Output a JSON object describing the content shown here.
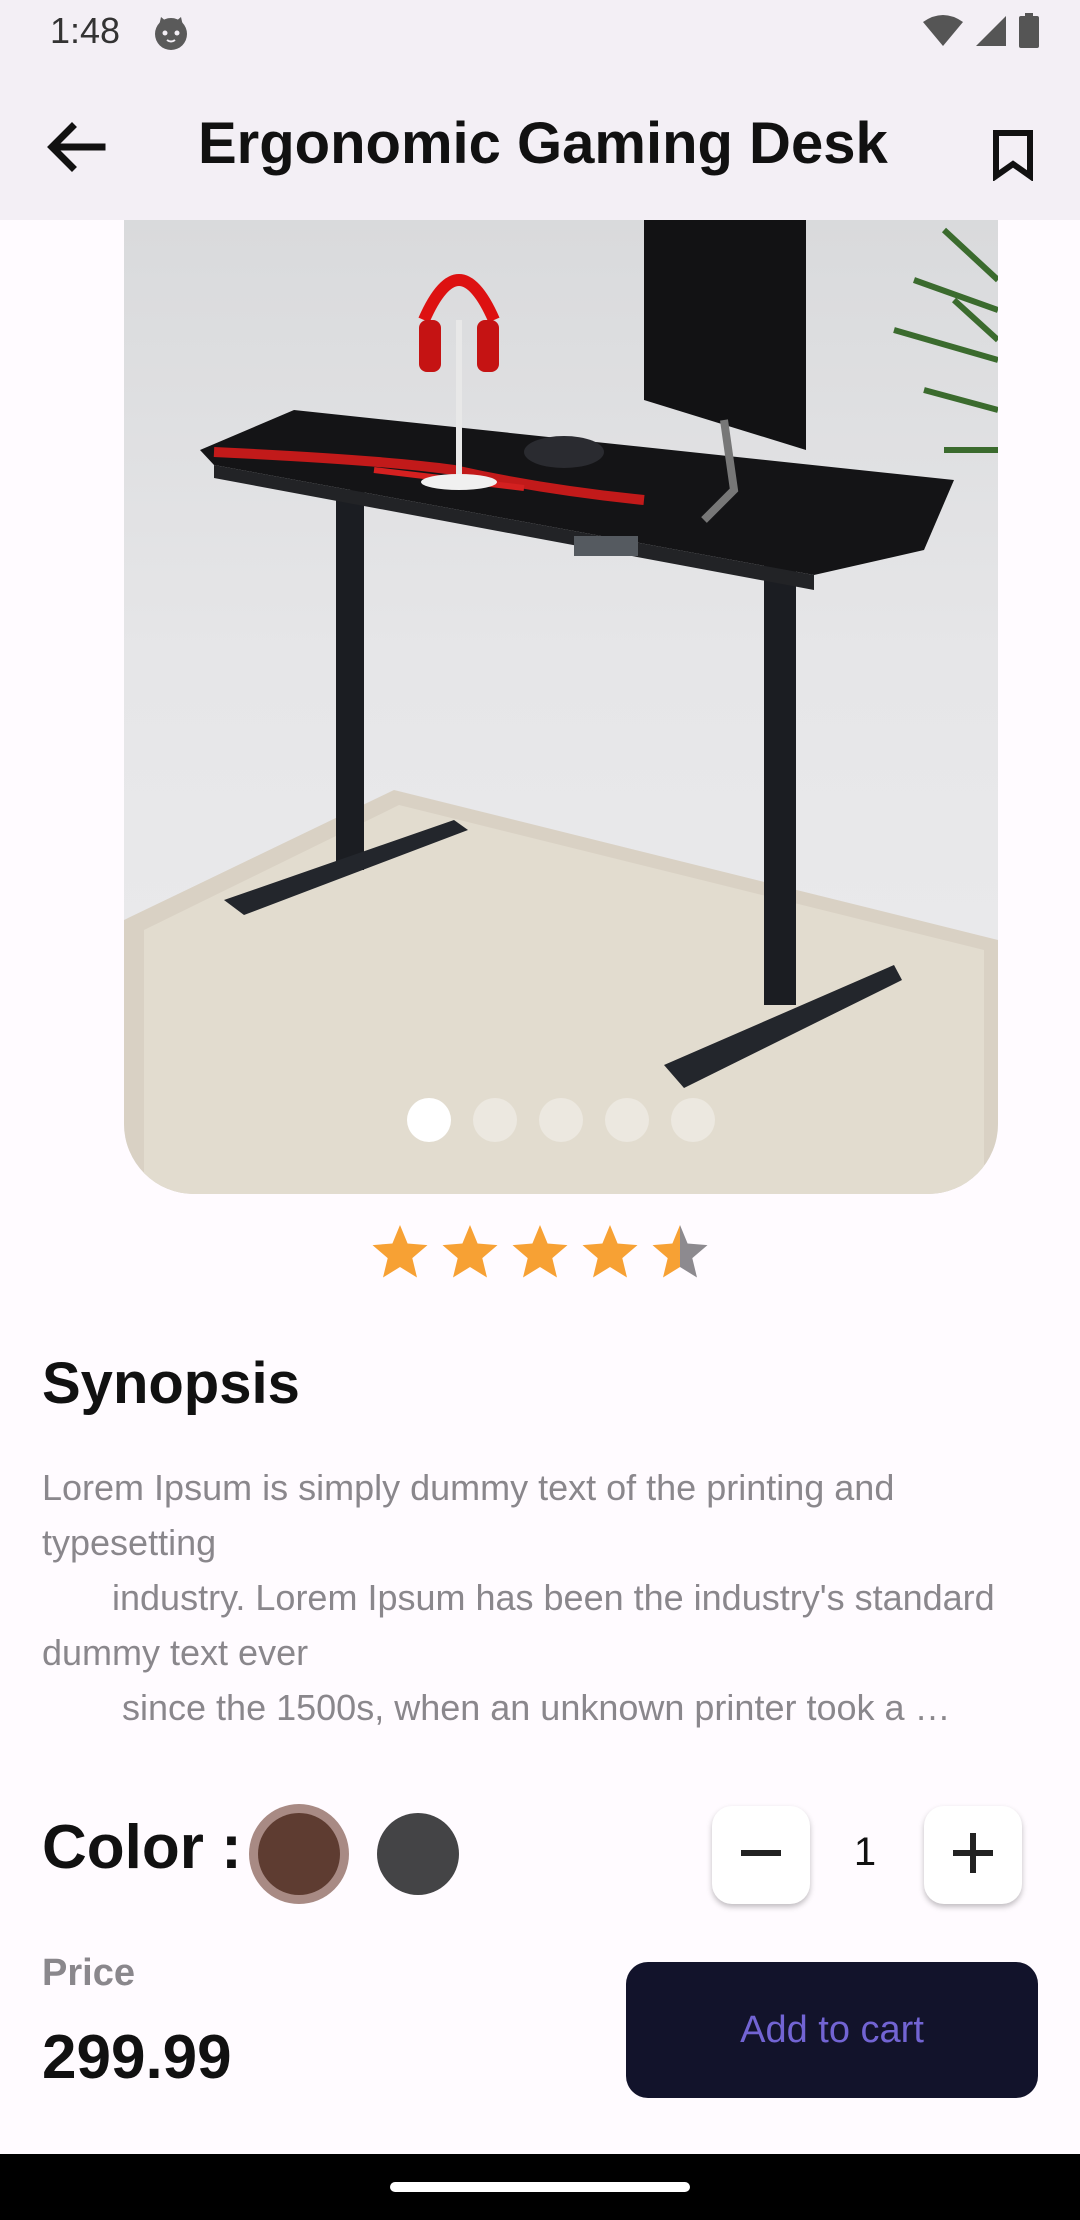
{
  "status_bar": {
    "time": "1:48",
    "icons": [
      "cat-notification-icon",
      "wifi-icon",
      "signal-icon",
      "battery-icon"
    ]
  },
  "app_bar": {
    "title": "Ergonomic Gaming Desk",
    "back_icon": "arrow-left-icon",
    "bookmark_icon": "bookmark-outline-icon"
  },
  "gallery": {
    "page_count": 5,
    "active_index": 0
  },
  "rating": {
    "value": 4.5,
    "max": 5,
    "color": "#f7a134"
  },
  "synopsis": {
    "heading": "Synopsis",
    "text": "Lorem Ipsum is simply dummy text of the printing and typesetting\n       industry. Lorem Ipsum has been the industry's standard dummy text ever\n        since the 1500s, when an unknown printer took a …"
  },
  "color_picker": {
    "label": "Color :",
    "options": [
      {
        "name": "brown",
        "hex": "#5e3c31",
        "selected": true
      },
      {
        "name": "dark-grey",
        "hex": "#444446",
        "selected": false
      }
    ]
  },
  "quantity": {
    "value": "1",
    "decrement_icon": "minus-icon",
    "increment_icon": "plus-icon"
  },
  "price": {
    "label": "Price",
    "value": "299.99"
  },
  "cart": {
    "button_label": "Add to cart",
    "bg_color": "#12132b",
    "text_color": "#7264d3"
  }
}
